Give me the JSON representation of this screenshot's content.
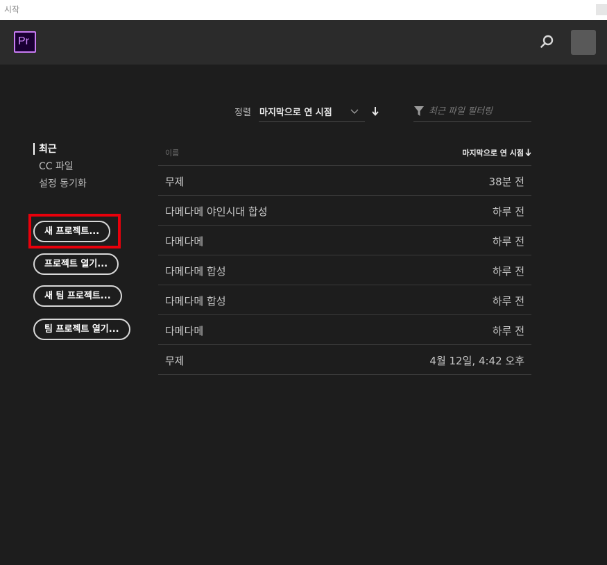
{
  "window": {
    "title": "시작"
  },
  "header": {
    "logo_text": "Pr",
    "accent": "#c97cf4"
  },
  "sort": {
    "label": "정렬",
    "value": "마지막으로 연 시점"
  },
  "filter": {
    "placeholder": "최근 파일 필터링"
  },
  "nav": {
    "items": [
      {
        "label": "최근",
        "active": true
      },
      {
        "label": "CC 파일",
        "active": false
      },
      {
        "label": "설정 동기화",
        "active": false
      }
    ]
  },
  "actions": {
    "new_project": "새 프로젝트...",
    "open_project": "프로젝트 열기...",
    "new_team_project": "새 팀 프로젝트...",
    "open_team_project": "팀 프로젝트 열기..."
  },
  "table": {
    "col_name": "이름",
    "col_date": "마지막으로 연 시점",
    "rows": [
      {
        "name": "무제",
        "date": "38분 전"
      },
      {
        "name": "다메다메 야인시대 합성",
        "date": "하루 전"
      },
      {
        "name": "다메다메",
        "date": "하루 전"
      },
      {
        "name": "다메다메 합성",
        "date": "하루 전"
      },
      {
        "name": "다메다메 합성",
        "date": "하루 전"
      },
      {
        "name": "다메다메",
        "date": "하루 전"
      },
      {
        "name": "무제",
        "date": "4월 12일, 4:42 오후"
      }
    ]
  },
  "highlight_color": "#e8000b"
}
